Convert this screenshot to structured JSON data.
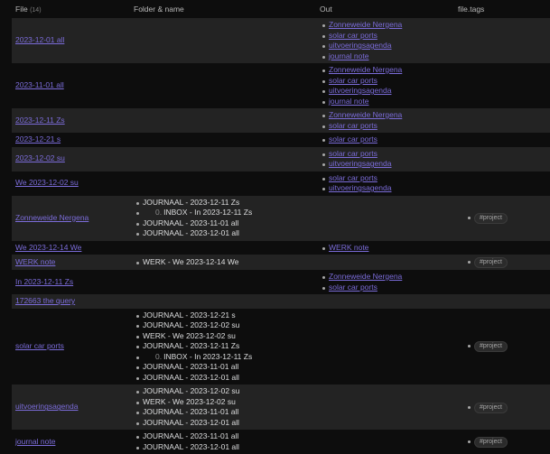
{
  "header": {
    "file_label": "File",
    "file_count": "(14)",
    "folder_label": "Folder & name",
    "out_label": "Out",
    "tags_label": "file.tags"
  },
  "rows": [
    {
      "file": "2023-12-01 all",
      "inlinks": [],
      "out": [
        "Zonneweide Nergena",
        "solar car ports",
        "uitvoeringsagenda",
        "journal note"
      ],
      "tags": []
    },
    {
      "file": "2023-11-01 all",
      "inlinks": [],
      "out": [
        "Zonneweide Nergena",
        "solar car ports",
        "uitvoeringsagenda",
        "journal note"
      ],
      "tags": []
    },
    {
      "file": "2023-12-11 Zs",
      "inlinks": [],
      "out": [
        "Zonneweide Nergena",
        "solar car ports"
      ],
      "tags": []
    },
    {
      "file": "2023-12-21 s",
      "inlinks": [],
      "out": [
        "solar car ports"
      ],
      "tags": []
    },
    {
      "file": "2023-12-02 su",
      "inlinks": [],
      "out": [
        "solar car ports",
        "uitvoeringsagenda"
      ],
      "tags": []
    },
    {
      "file": "We 2023-12-02 su",
      "inlinks": [],
      "out": [
        "solar car ports",
        "uitvoeringsagenda"
      ],
      "tags": []
    },
    {
      "file": "Zonneweide Nergena",
      "inlinks": [
        {
          "text": "JOURNAAL - 2023-12-11 Zs"
        },
        {
          "num": "0.",
          "text": "INBOX - In 2023-12-11 Zs"
        },
        {
          "text": "JOURNAAL - 2023-11-01 all"
        },
        {
          "text": "JOURNAAL - 2023-12-01 all"
        }
      ],
      "out": [],
      "tags": [
        "#project"
      ]
    },
    {
      "file": "We 2023-12-14 We",
      "inlinks": [],
      "out": [
        "WERK note"
      ],
      "tags": []
    },
    {
      "file": "WERK note",
      "inlinks": [
        {
          "text": "WERK - We 2023-12-14 We"
        }
      ],
      "out": [],
      "tags": [
        "#project"
      ]
    },
    {
      "file": "In 2023-12-11 Zs",
      "inlinks": [],
      "out": [
        "Zonneweide Nergena",
        "solar car ports"
      ],
      "tags": []
    },
    {
      "file": "172663 the query",
      "inlinks": [],
      "out": [],
      "tags": []
    },
    {
      "file": "solar car ports",
      "inlinks": [
        {
          "text": "JOURNAAL - 2023-12-21 s"
        },
        {
          "text": "JOURNAAL - 2023-12-02 su"
        },
        {
          "text": "WERK - We 2023-12-02 su"
        },
        {
          "text": "JOURNAAL - 2023-12-11 Zs"
        },
        {
          "num": "0.",
          "text": "INBOX - In 2023-12-11 Zs"
        },
        {
          "text": "JOURNAAL - 2023-11-01 all"
        },
        {
          "text": "JOURNAAL - 2023-12-01 all"
        }
      ],
      "out": [],
      "tags": [
        "#project"
      ]
    },
    {
      "file": "uitvoeringsagenda",
      "inlinks": [
        {
          "text": "JOURNAAL - 2023-12-02 su"
        },
        {
          "text": "WERK - We 2023-12-02 su"
        },
        {
          "text": "JOURNAAL - 2023-11-01 all"
        },
        {
          "text": "JOURNAAL - 2023-12-01 all"
        }
      ],
      "out": [],
      "tags": [
        "#project"
      ]
    },
    {
      "file": "journal note",
      "inlinks": [
        {
          "text": "JOURNAAL - 2023-11-01 all"
        },
        {
          "text": "JOURNAAL - 2023-12-01 all"
        }
      ],
      "out": [],
      "tags": [
        "#project"
      ]
    }
  ]
}
